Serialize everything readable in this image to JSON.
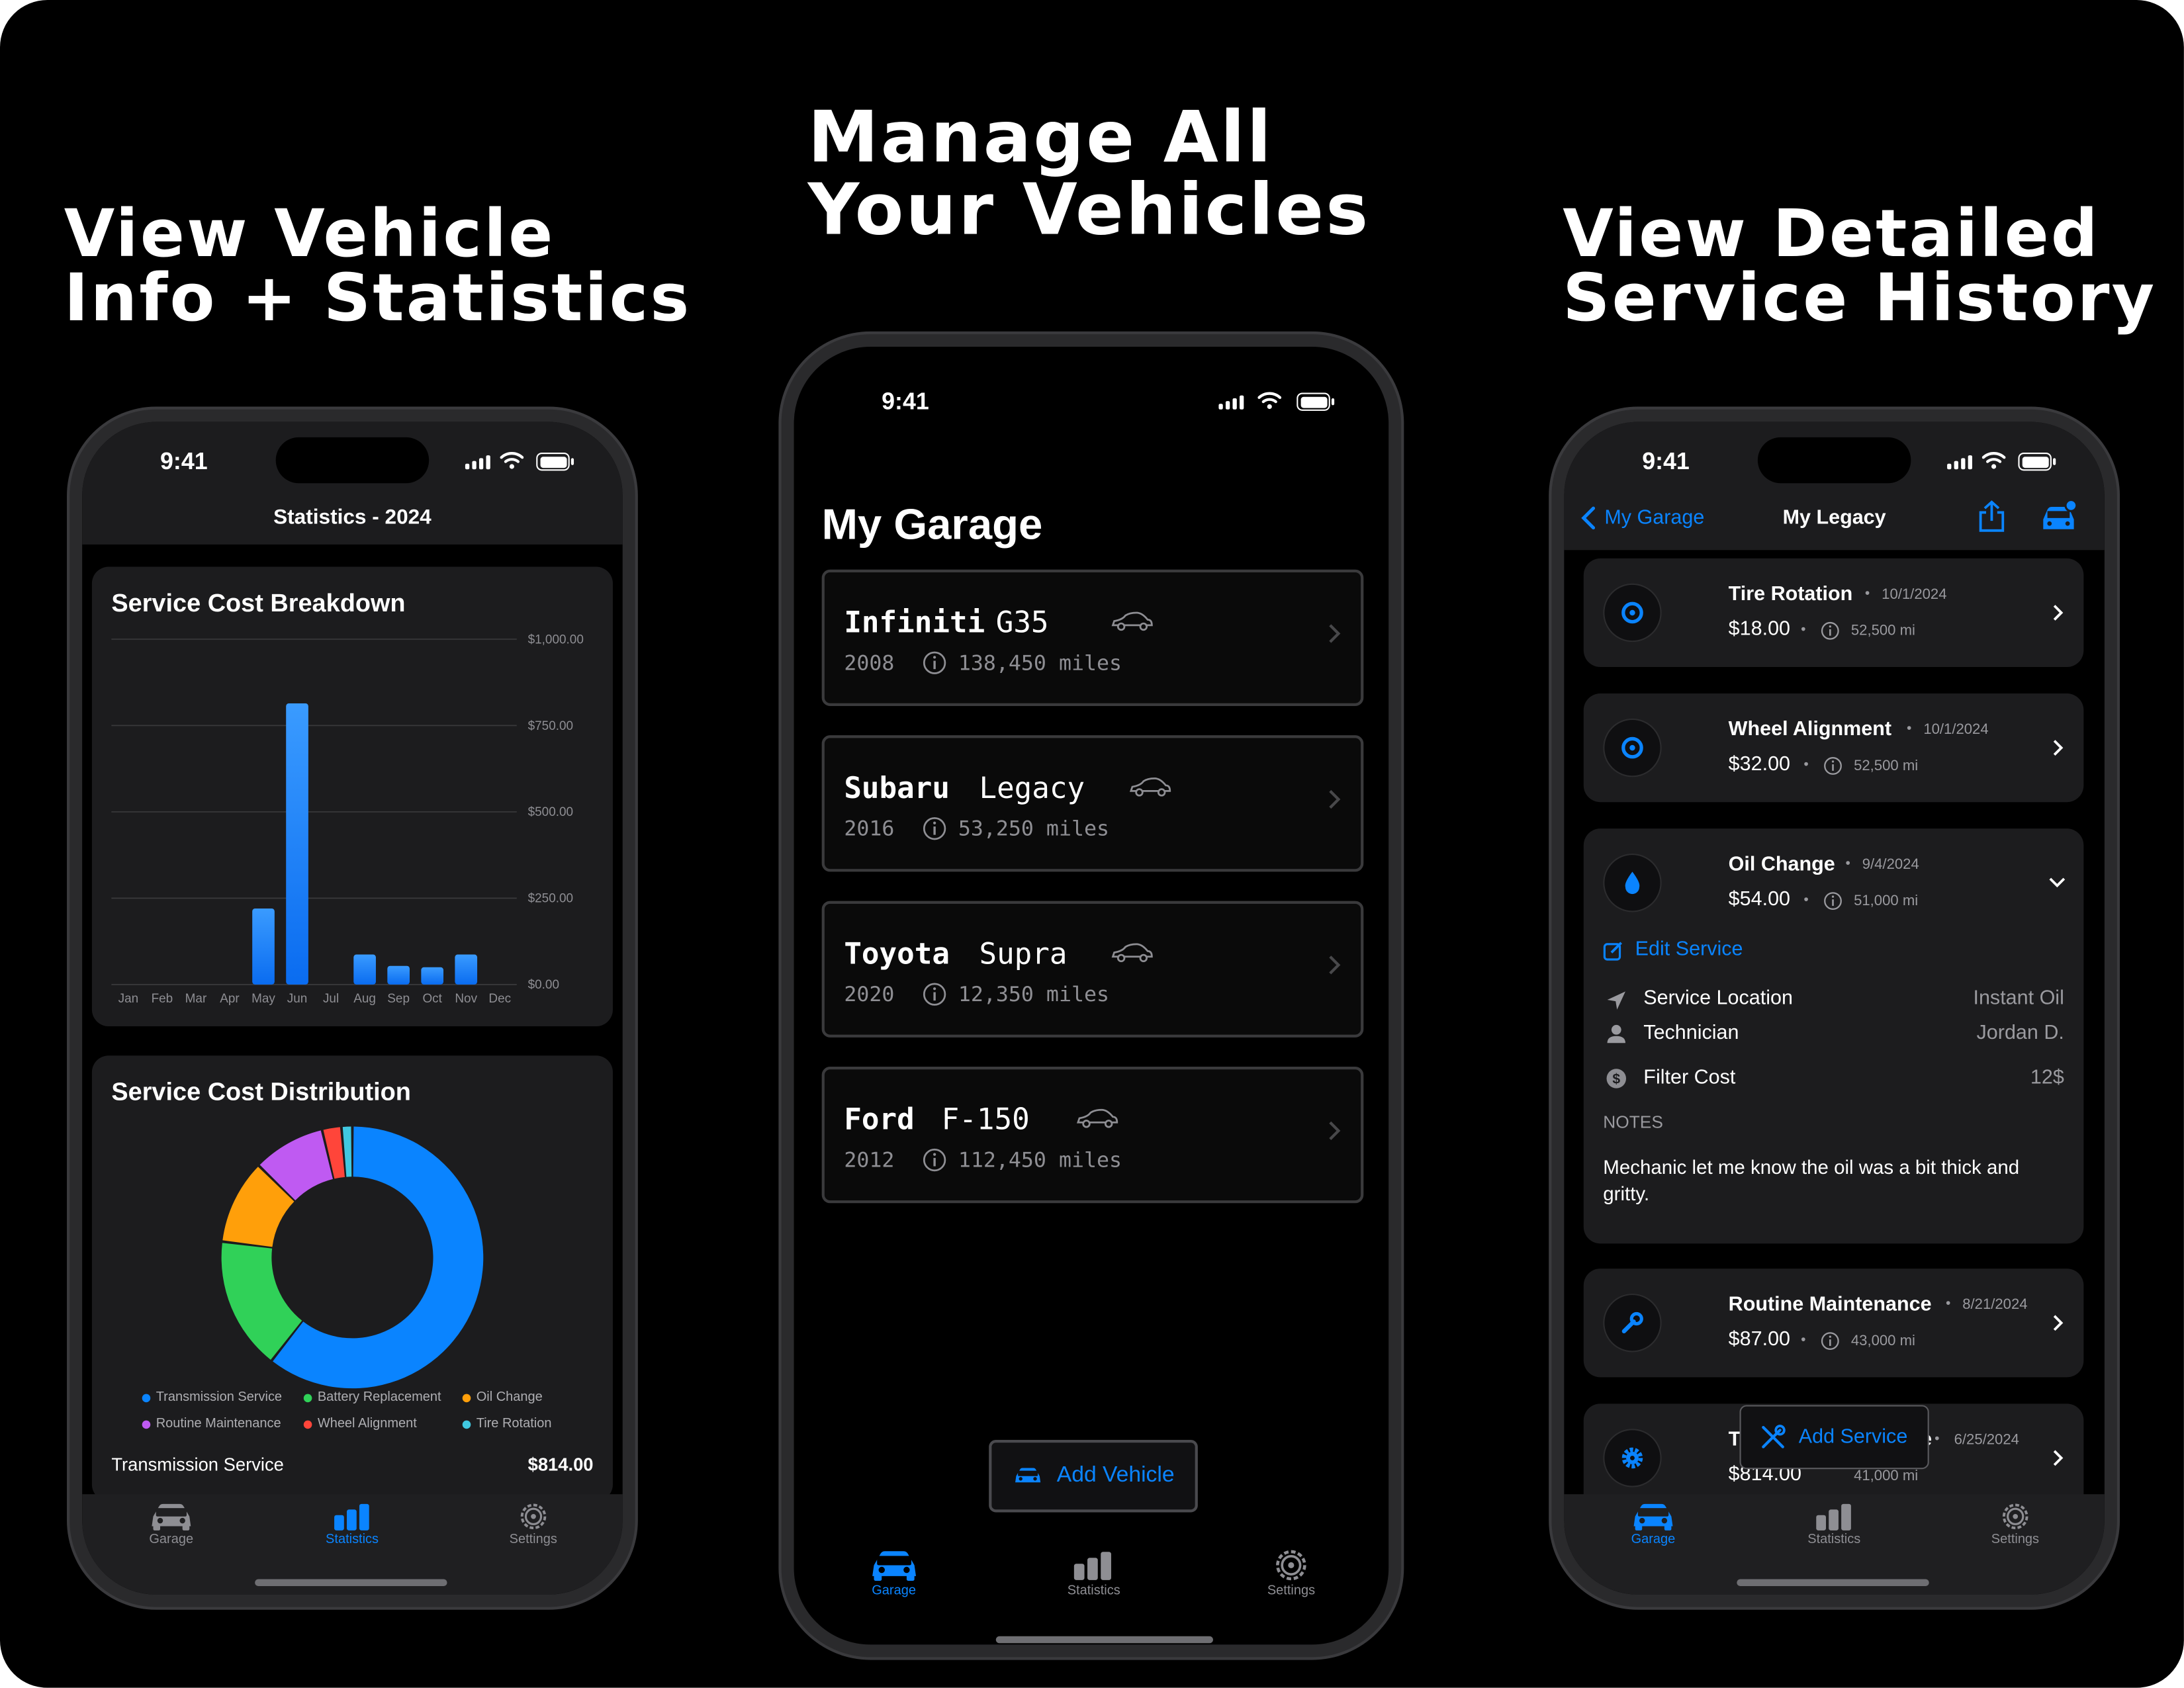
{
  "headlines": {
    "left": [
      "View Vehicle",
      "Info + Statistics"
    ],
    "center": [
      "Manage All",
      "Your Vehicles"
    ],
    "right": [
      "View Detailed",
      "Service History"
    ]
  },
  "status_time": "9:41",
  "tabs": {
    "garage": "Garage",
    "statistics": "Statistics",
    "settings": "Settings"
  },
  "stats_screen": {
    "nav_title": "Statistics - 2024",
    "breakdown_title": "Service Cost Breakdown",
    "distribution_title": "Service Cost Distribution",
    "footer_label": "Transmission Service",
    "footer_value": "$814.00"
  },
  "chart_data": [
    {
      "type": "bar",
      "title": "Service Cost Breakdown",
      "categories": [
        "Jan",
        "Feb",
        "Mar",
        "Apr",
        "May",
        "Jun",
        "Jul",
        "Aug",
        "Sep",
        "Oct",
        "Nov",
        "Dec"
      ],
      "values": [
        0,
        0,
        0,
        0,
        220,
        814,
        0,
        87,
        54,
        50,
        87,
        0
      ],
      "ylim": [
        0,
        1000
      ],
      "yticks": [
        "$1,000.00",
        "$750.00",
        "$500.00",
        "$250.00",
        "$0.00"
      ],
      "ytick_values": [
        1000,
        750,
        500,
        250,
        0
      ],
      "color": "#0a84ff"
    },
    {
      "type": "pie",
      "title": "Service Cost Distribution",
      "donut": true,
      "labels": [
        "Transmission Service",
        "Battery Replacement",
        "Oil Change",
        "Routine Maintenance",
        "Wheel Alignment",
        "Tire Rotation"
      ],
      "values": [
        814,
        220,
        140,
        120,
        32,
        18
      ],
      "colors": [
        "#0a84ff",
        "#30d158",
        "#ff9f0a",
        "#bf5af2",
        "#ff453a",
        "#40c8e0"
      ]
    }
  ],
  "garage_screen": {
    "title": "My Garage",
    "add_label": "Add Vehicle",
    "vehicles": [
      {
        "make": "Infiniti",
        "model": "G35",
        "year": "2008",
        "miles": "138,450 miles"
      },
      {
        "make": "Subaru",
        "model": "Legacy",
        "year": "2016",
        "miles": "53,250 miles"
      },
      {
        "make": "Toyota",
        "model": "Supra",
        "year": "2020",
        "miles": "12,350 miles"
      },
      {
        "make": "Ford",
        "model": "F-150",
        "year": "2012",
        "miles": "112,450 miles"
      }
    ]
  },
  "detail_screen": {
    "back_label": "My Garage",
    "title": "My Legacy",
    "services": [
      {
        "name": "Tire Rotation",
        "date": "10/1/2024",
        "cost": "$18.00",
        "miles": "52,500 mi",
        "icon": "tire-icon"
      },
      {
        "name": "Wheel Alignment",
        "date": "10/1/2024",
        "cost": "$32.00",
        "miles": "52,500 mi",
        "icon": "tire-icon"
      },
      {
        "name": "Oil Change",
        "date": "9/4/2024",
        "cost": "$54.00",
        "miles": "51,000 mi",
        "icon": "oil-drop-icon"
      },
      {
        "name": "Routine Maintenance",
        "date": "8/21/2024",
        "cost": "$87.00",
        "miles": "43,000 mi",
        "icon": "wrench-icon"
      },
      {
        "name": "T",
        "name_tail": "e",
        "date": "6/25/2024",
        "cost": "$814.00",
        "miles": "41,000 mi",
        "icon": "gear-icon"
      }
    ],
    "edit_label": "Edit Service",
    "details": [
      {
        "label": "Service Location",
        "value": "Instant Oil"
      },
      {
        "label": "Technician",
        "value": "Jordan D."
      },
      {
        "label": "Filter Cost",
        "value": "12$"
      }
    ],
    "notes_label": "NOTES",
    "notes_text": "Mechanic let me know the oil was a bit thick and gritty.",
    "add_service_label": "Add Service"
  },
  "colors": {
    "accent": "#0a84ff",
    "card": "#1c1c1e",
    "background": "#000000"
  }
}
